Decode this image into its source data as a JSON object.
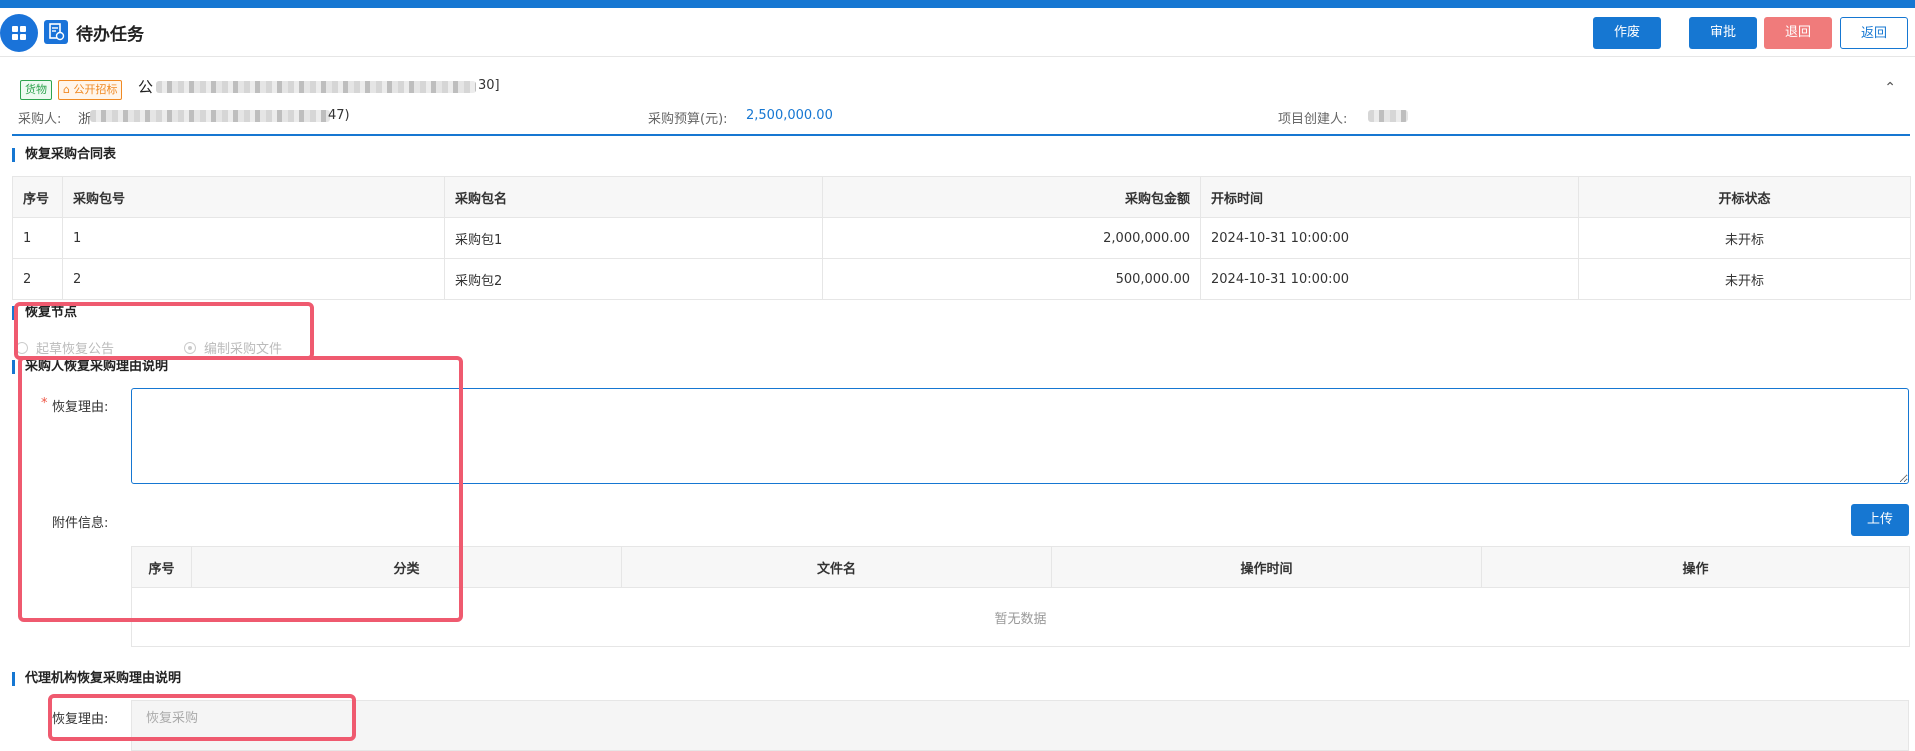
{
  "header": {
    "title": "待办任务",
    "buttons": {
      "void": "作废",
      "approve": "审批",
      "reject": "退回",
      "back": "返回"
    }
  },
  "project": {
    "tag_goods": "货物",
    "tag_tender": "公开招标",
    "name_prefix": "公",
    "name_suffix": "30]",
    "buyer_label": "采购人:",
    "buyer_prefix": "浙",
    "buyer_suffix": "47)",
    "budget_label": "采购预算(元):",
    "budget_value": "2,500,000.00",
    "creator_label": "项目创建人:"
  },
  "contract_table": {
    "section_title": "恢复采购合同表",
    "headers": [
      "序号",
      "采购包号",
      "采购包名",
      "采购包金额",
      "开标时间",
      "开标状态"
    ],
    "rows": [
      [
        "1",
        "1",
        "采购包1",
        "2,000,000.00",
        "2024-10-31 10:00:00",
        "未开标"
      ],
      [
        "2",
        "2",
        "采购包2",
        "500,000.00",
        "2024-10-31 10:00:00",
        "未开标"
      ]
    ]
  },
  "restore_node": {
    "section_title": "恢复节点",
    "options": [
      "起草恢复公告",
      "编制采购文件"
    ],
    "selected": "编制采购文件"
  },
  "buyer_reason": {
    "section_title": "采购人恢复采购理由说明",
    "reason_label": "恢复理由:",
    "required_mark": "*",
    "reason_value": "",
    "attachment_label": "附件信息:",
    "upload_button": "上传",
    "attachment_headers": [
      "序号",
      "分类",
      "文件名",
      "操作时间",
      "操作"
    ],
    "empty_text": "暂无数据"
  },
  "agency_reason": {
    "section_title": "代理机构恢复采购理由说明",
    "reason_label": "恢复理由:",
    "reason_value": "恢复采购"
  },
  "colors": {
    "primary": "#1677d2",
    "danger": "#f07b7b",
    "highlight": "#ef5a6f",
    "tag_green": "#2ea44f",
    "tag_orange": "#f08a24"
  }
}
